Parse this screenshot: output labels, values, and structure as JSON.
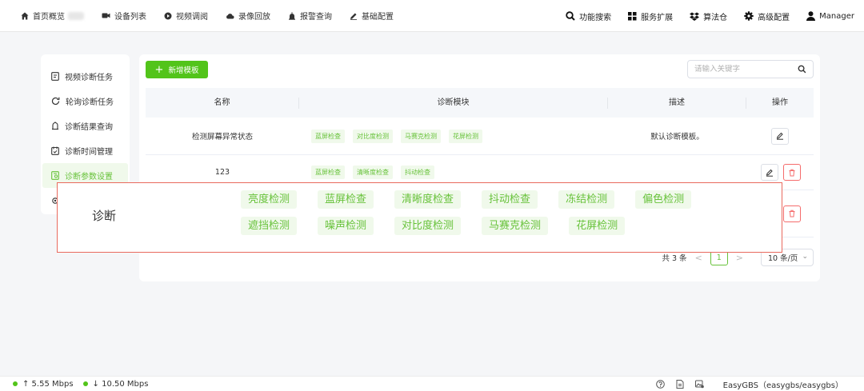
{
  "topnav": {
    "left": [
      {
        "label": "首页概览",
        "icon": "home-icon"
      },
      {
        "label": "设备列表",
        "icon": "video-camera-icon"
      },
      {
        "label": "视频调阅",
        "icon": "play-circle-icon"
      },
      {
        "label": "录像回放",
        "icon": "cloud-icon"
      },
      {
        "label": "报警查询",
        "icon": "alarm-icon"
      },
      {
        "label": "基础配置",
        "icon": "pen-icon"
      }
    ],
    "right": [
      {
        "label": "功能搜索",
        "icon": "search-icon"
      },
      {
        "label": "服务扩展",
        "icon": "grid-icon"
      },
      {
        "label": "算法仓",
        "icon": "dropbox-icon"
      },
      {
        "label": "高级配置",
        "icon": "gear-icon"
      },
      {
        "label": "Manager",
        "icon": "user-icon"
      }
    ]
  },
  "sidebar": {
    "items": [
      {
        "label": "视频诊断任务",
        "icon": "task-icon"
      },
      {
        "label": "轮询诊断任务",
        "icon": "refresh-icon"
      },
      {
        "label": "诊断结果查询",
        "icon": "result-icon"
      },
      {
        "label": "诊断时间管理",
        "icon": "calendar-icon"
      },
      {
        "label": "诊断参数设置",
        "icon": "settings-doc-icon",
        "active": true
      },
      {
        "label": "",
        "icon": "gear-icon"
      }
    ]
  },
  "toolbar": {
    "add_label": "新增模板",
    "search_placeholder": "请输入关键字"
  },
  "table": {
    "headers": [
      "名称",
      "诊断模块",
      "描述",
      "操作"
    ],
    "rows": [
      {
        "name": "检测屏幕异常状态",
        "modules": [
          "蓝屏检查",
          "对比度检测",
          "马赛克检测",
          "花屏检测"
        ],
        "desc": "默认诊断模板。"
      },
      {
        "name": "123",
        "modules": [
          "蓝屏检查",
          "清晰度检查",
          "抖动检查"
        ],
        "desc": ""
      }
    ]
  },
  "pagination": {
    "total": "共 3 条",
    "prev": "<",
    "page": "1",
    "next": ">",
    "size": "10 条/页"
  },
  "overlay": {
    "label": "诊断",
    "row1": [
      "亮度检测",
      "蓝屏检查",
      "清晰度检查",
      "抖动检查",
      "冻结检测",
      "偏色检测"
    ],
    "row2": [
      "遮挡检测",
      "噪声检测",
      "对比度检测",
      "马赛克检测",
      "花屏检测"
    ]
  },
  "status": {
    "upload": "↑ 5.55 Mbps",
    "download": "↓ 10.50 Mbps",
    "product": "EasyGBS（easygbs/easygbs）"
  },
  "colors": {
    "accent": "#52c41a",
    "tag_text": "#67c23a",
    "tag_bg": "#f0f9eb",
    "danger": "#f56c6c",
    "overlay_border": "#e96a5e"
  }
}
